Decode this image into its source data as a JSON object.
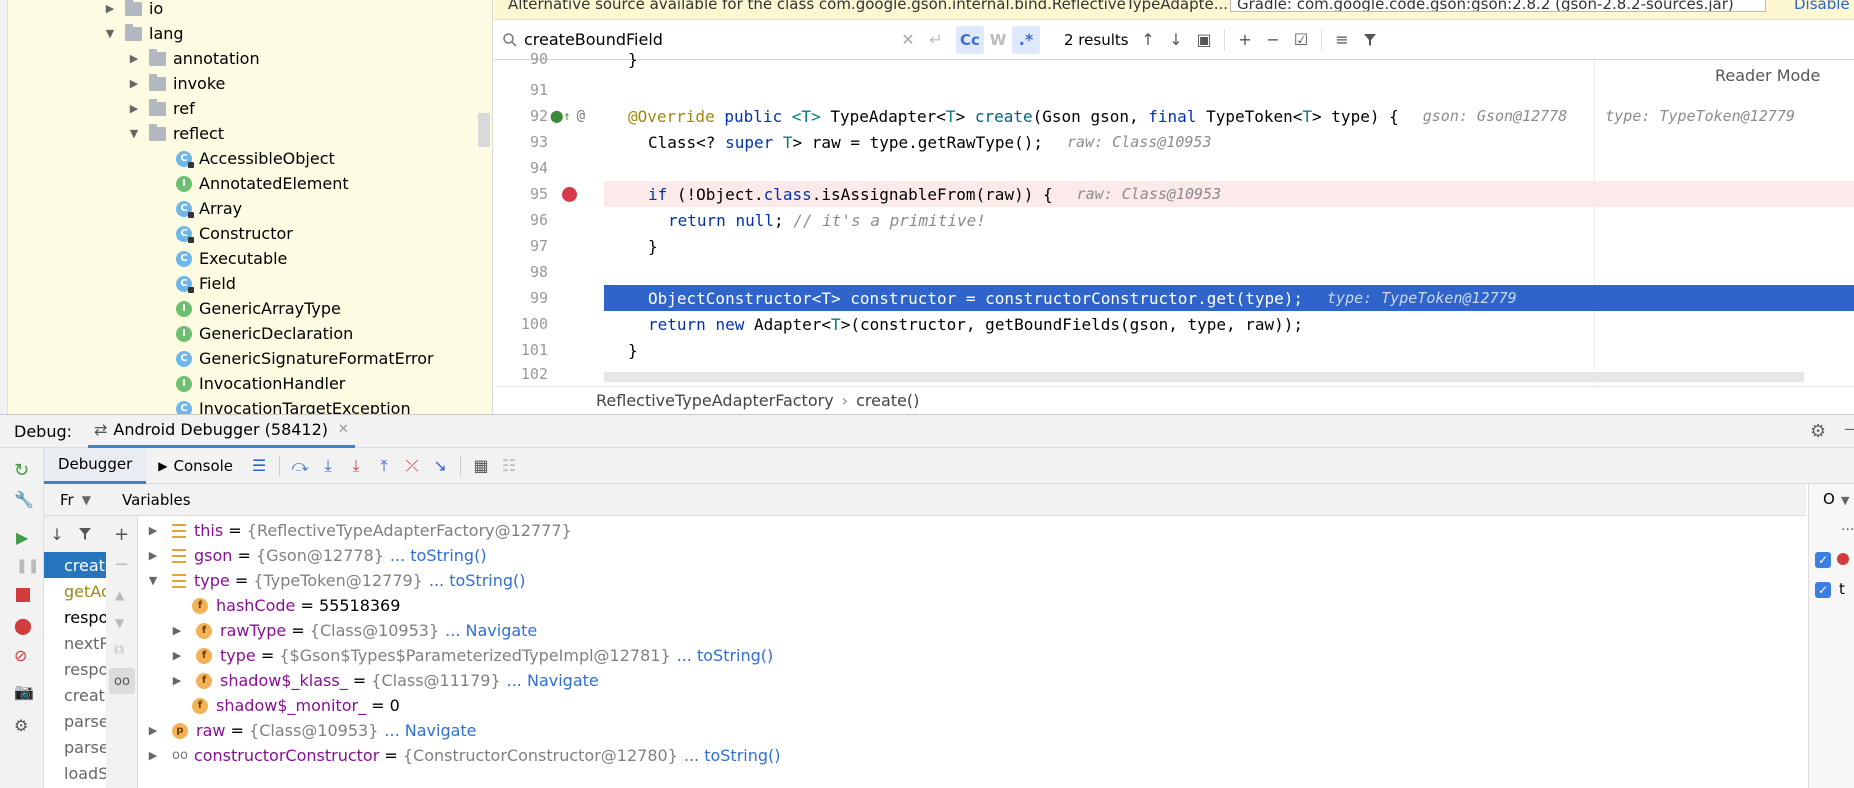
{
  "project_tree": {
    "items": [
      {
        "label": "io",
        "kind": "folder",
        "expanded": false
      },
      {
        "label": "lang",
        "kind": "folder",
        "expanded": true
      },
      {
        "label": "annotation",
        "kind": "folder",
        "expanded": false
      },
      {
        "label": "invoke",
        "kind": "folder",
        "expanded": false
      },
      {
        "label": "ref",
        "kind": "folder",
        "expanded": false
      },
      {
        "label": "reflect",
        "kind": "folder",
        "expanded": true
      },
      {
        "label": "AccessibleObject",
        "kind": "class"
      },
      {
        "label": "AnnotatedElement",
        "kind": "interface"
      },
      {
        "label": "Array",
        "kind": "class"
      },
      {
        "label": "Constructor",
        "kind": "class"
      },
      {
        "label": "Executable",
        "kind": "class"
      },
      {
        "label": "Field",
        "kind": "class"
      },
      {
        "label": "GenericArrayType",
        "kind": "interface"
      },
      {
        "label": "GenericDeclaration",
        "kind": "interface"
      },
      {
        "label": "GenericSignatureFormatError",
        "kind": "class"
      },
      {
        "label": "InvocationHandler",
        "kind": "interface"
      },
      {
        "label": "InvocationTargetException",
        "kind": "class"
      }
    ]
  },
  "editor": {
    "banner_text": "Alternative source available for the class com.google.gson.internal.bind.ReflectiveTypeAdapte...",
    "banner_select": "Gradle: com.google.code.gson:gson:2.8.2 (gson-2.8.2-sources.jar)",
    "banner_disable": "Disable",
    "search_value": "createBoundField",
    "search_match_case": "Cc",
    "search_words": "W",
    "search_regex": ".*",
    "results_text": "2 results",
    "reader_mode": "Reader Mode",
    "lines": {
      "n90": "90",
      "n91": "91",
      "n92": "92",
      "n93": "93",
      "n94": "94",
      "n95": "95",
      "n96": "96",
      "n97": "97",
      "n98": "98",
      "n99": "99",
      "n100": "100",
      "n101": "101",
      "n102": "102",
      "l90_brace": "}",
      "l92_ann": "@Override",
      "l92_kw1": "public",
      "l92_t1": "<T>",
      "l92_type": "TypeAdapter<",
      "l92_t2": "T",
      "l92_close": ">",
      "l92_fn": "create",
      "l92_args1": "(Gson gson,",
      "l92_final": "final",
      "l92_args2": "TypeToken<",
      "l92_t3": "T",
      "l92_args3": "> type) {",
      "l92_hint1": "gson: Gson@12778",
      "l92_hint2": "type: TypeToken@12779",
      "l93_a": "Class<?",
      "l93_super": "super",
      "l93_t": "T",
      "l93_b": "> raw = type.getRawType();",
      "l93_hint": "raw: Class@10953",
      "l95_if": "if",
      "l95_a": "(!Object.",
      "l95_class": "class",
      "l95_b": ".isAssignableFrom(raw)) {",
      "l95_hint": "raw: Class@10953",
      "l96_ret": "return",
      "l96_null": "null",
      "l96_semi": ";",
      "l96_cm": "// it's a primitive!",
      "l97_brace": "}",
      "l99_code": "ObjectConstructor<T> constructor = constructorConstructor.get(type);",
      "l99_hint": "type: TypeToken@12779",
      "l100_ret": "return",
      "l100_new": "new",
      "l100_a": "Adapter<",
      "l100_t": "T",
      "l100_b": ">(constructor, getBoundFields(gson, type, raw));",
      "l101_brace": "}"
    }
  },
  "breadcrumb": {
    "class_name": "ReflectiveTypeAdapterFactory",
    "separator": "›",
    "method": "create()"
  },
  "debug": {
    "label": "Debug:",
    "session_tab": "Android Debugger (58412)",
    "tab_debugger": "Debugger",
    "tab_console": "Console",
    "frames_label": "Fr",
    "variables_label": "Variables",
    "right_header": "O",
    "right_dots": "...",
    "right_item": "t",
    "frames": [
      "create",
      "getAd",
      "respo",
      "nextR",
      "respo",
      "create",
      "parse",
      "parse",
      "loadS"
    ],
    "variables": [
      {
        "name": "this",
        "value": "{ReflectiveTypeAdapterFactory@12777}",
        "link": ""
      },
      {
        "name": "gson",
        "value": "{Gson@12778}",
        "link": "... toString()"
      },
      {
        "name": "type",
        "value": "{TypeToken@12779}",
        "link": "... toString()"
      },
      {
        "name": "hashCode",
        "value": "55518369",
        "link": "",
        "badge": "f"
      },
      {
        "name": "rawType",
        "value": "{Class@10953}",
        "link": "... Navigate",
        "badge": "f"
      },
      {
        "name": "type",
        "value": "{$Gson$Types$ParameterizedTypeImpl@12781}",
        "link": "... toString()",
        "badge": "f"
      },
      {
        "name": "shadow$_klass_",
        "value": "{Class@11179}",
        "link": "... Navigate",
        "badge": "f"
      },
      {
        "name": "shadow$_monitor_",
        "value": "0",
        "link": "",
        "badge": "f"
      },
      {
        "name": "raw",
        "value": "{Class@10953}",
        "link": "... Navigate",
        "badge": "p"
      },
      {
        "name": "constructorConstructor",
        "value": "{ConstructorConstructor@12780}",
        "link": "... toString()"
      }
    ]
  },
  "colors": {
    "accent": "#2f65ca",
    "tree_bg": "#fdfbe1",
    "breakpoint_line": "#fbeae8",
    "selected_frame": "#2675bf"
  }
}
